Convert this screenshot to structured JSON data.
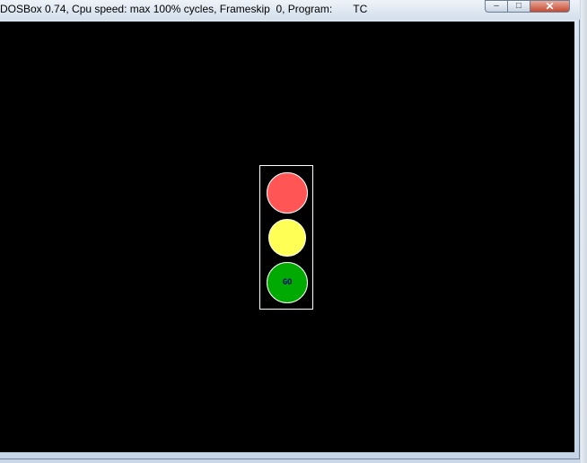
{
  "window": {
    "title": "DOSBox 0.74, Cpu speed: max 100% cycles, Frameskip  0, Program:       TC",
    "controls": {
      "minimize_icon": "minimize-icon",
      "maximize_icon": "maximize-icon",
      "close_icon": "close-icon"
    }
  },
  "traffic_light": {
    "lamps": [
      {
        "color": "#ff5555",
        "state": "red"
      },
      {
        "color": "#ffff55",
        "state": "yellow"
      },
      {
        "color": "#00aa00",
        "state": "green",
        "label": "GO"
      }
    ]
  }
}
